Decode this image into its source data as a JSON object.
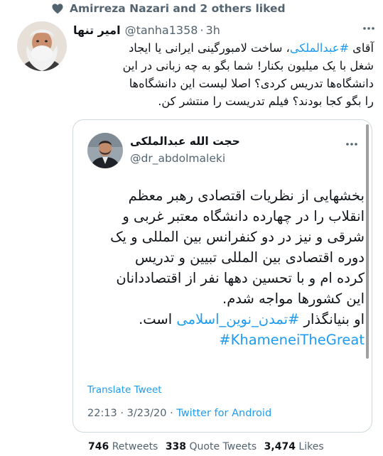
{
  "liked_by": {
    "text": "Amirreza Nazari and 2 others liked",
    "icon": "heart-icon"
  },
  "tweet": {
    "author_name": "امیر تنها",
    "handle": "@tanha1358",
    "separator": "·",
    "time": "3h",
    "lines": [
      {
        "pre": "آقای ",
        "hashtag": "#عبدالملکی",
        "post": "، ساخت لامبورگینی ایرانی یا ایجاد"
      },
      {
        "text": "شغل با یک میلیون بکنار! شما بگو به چه زبانی در این"
      },
      {
        "text": "دانشگاه‌ها تدریس کردی؟ اصلا لیست این دانشگاه‌ها"
      },
      {
        "text": "را بگو کجا بودند؟ فیلم تدریست را منتشر کن."
      }
    ]
  },
  "quoted": {
    "author_name": "حجت الله عبدالملکی",
    "handle": "@dr_abdolmaleki",
    "lines": [
      "بخشهایی از نظریات اقتصادی رهبر معظم",
      "انقلاب را در چهارده دانشگاه معتبر غربی و",
      "شرقی و نیز در دو کنفرانس بین المللی و یک",
      "دوره اقتصادی بین المللی تبیین و تدریس",
      "کرده ام و با تحسین دهها نفر از اقتصاددانان",
      "این کشورها مواجه شدم."
    ],
    "founder_line": {
      "pre": "او بنیانگذار ",
      "hashtag": "#تمدن_نوین_اسلامی",
      "post": " است."
    },
    "english_hashtag": "#KhameneiTheGreat",
    "translate_label": "Translate Tweet",
    "timestamp": "22:13 · 3/23/20 · ",
    "source": "Twitter for Android"
  },
  "stats": {
    "retweets_count": "746",
    "retweets_label": "Retweets",
    "quotes_count": "338",
    "quotes_label": "Quote Tweets",
    "likes_count": "3,474",
    "likes_label": "Likes"
  },
  "colors": {
    "link": "#1d9bf0",
    "secondary": "#536471",
    "text": "#0f1419",
    "border": "#cfd9de"
  }
}
